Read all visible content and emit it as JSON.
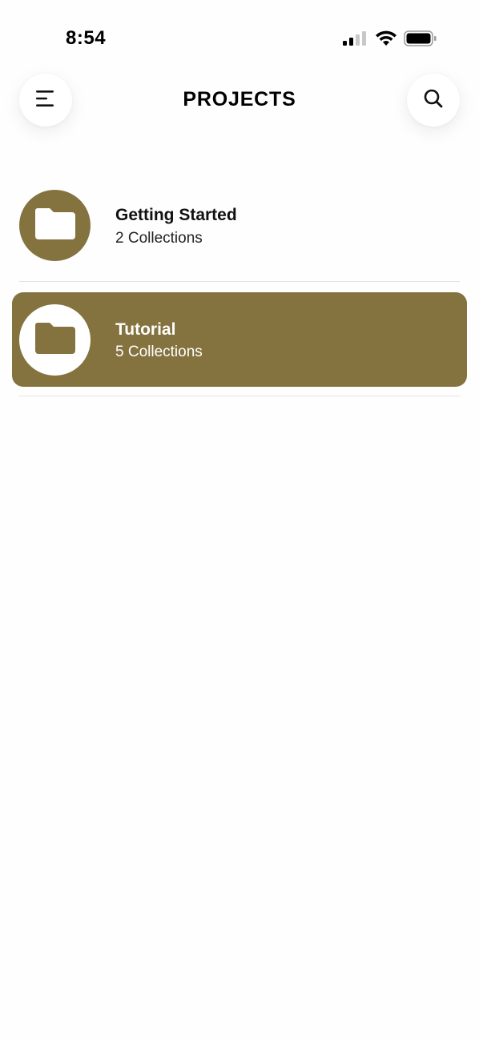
{
  "status_bar": {
    "time": "8:54"
  },
  "header": {
    "title": "PROJECTS",
    "menu_icon": "menu-icon",
    "search_icon": "search-icon"
  },
  "projects": [
    {
      "name": "Getting Started",
      "subtitle": "2 Collections",
      "icon": "folder-icon",
      "selected": false
    },
    {
      "name": "Tutorial",
      "subtitle": "5 Collections",
      "icon": "folder-icon",
      "selected": true
    }
  ],
  "colors": {
    "accent": "#85733f",
    "background": "#fefefe",
    "divider": "#e4e1e6"
  }
}
